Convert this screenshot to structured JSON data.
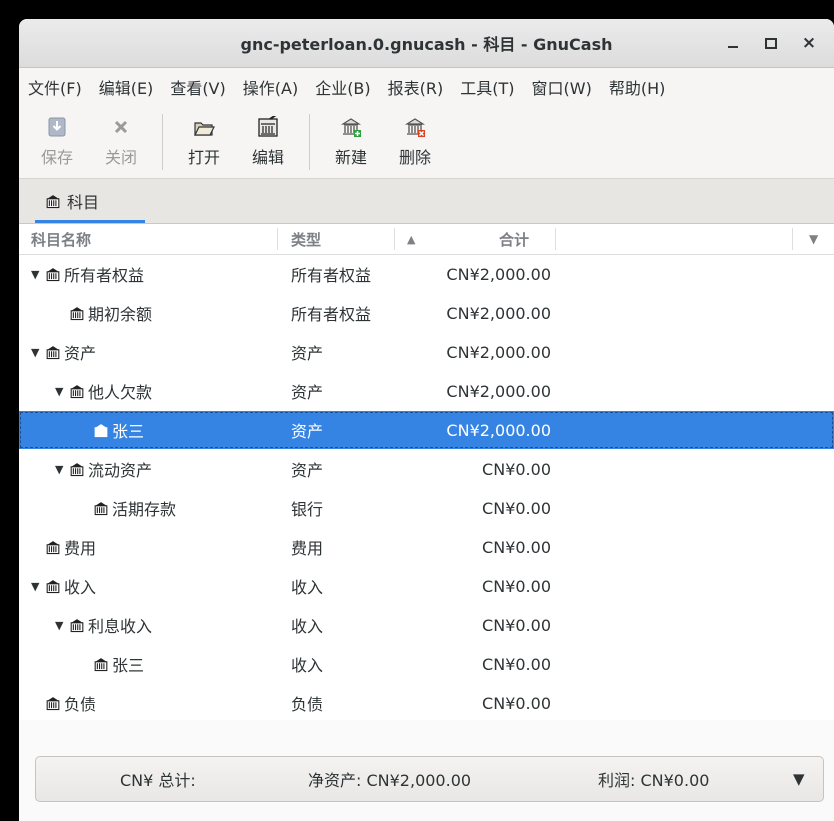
{
  "window": {
    "title": "gnc-peterloan.0.gnucash - 科目 - GnuCash",
    "controls": {
      "minimize": "–",
      "maximize": "□",
      "close": "×"
    }
  },
  "menubar": [
    "文件(F)",
    "编辑(E)",
    "查看(V)",
    "操作(A)",
    "企业(B)",
    "报表(R)",
    "工具(T)",
    "窗口(W)",
    "帮助(H)"
  ],
  "toolbar": {
    "save": {
      "label": "保存",
      "icon": "save-icon",
      "enabled": false
    },
    "close": {
      "label": "关闭",
      "icon": "close-icon",
      "enabled": false
    },
    "open": {
      "label": "打开",
      "icon": "folder-open-icon",
      "enabled": true
    },
    "edit": {
      "label": "编辑",
      "icon": "account-edit-icon",
      "enabled": true
    },
    "new": {
      "label": "新建",
      "icon": "account-new-icon",
      "enabled": true
    },
    "delete": {
      "label": "删除",
      "icon": "account-delete-icon",
      "enabled": true
    }
  },
  "tabs": [
    {
      "label": "科目",
      "icon": "account-icon",
      "active": true
    }
  ],
  "columns": {
    "name": "科目名称",
    "type": "类型",
    "total": "合计",
    "sort_indicator": "▲",
    "column_menu": "▼"
  },
  "accounts": [
    {
      "name": "所有者权益",
      "type": "所有者权益",
      "total": "CN¥2,000.00",
      "depth": 0,
      "expanded": true,
      "selected": false
    },
    {
      "name": "期初余额",
      "type": "所有者权益",
      "total": "CN¥2,000.00",
      "depth": 1,
      "expanded": null,
      "selected": false
    },
    {
      "name": "资产",
      "type": "资产",
      "total": "CN¥2,000.00",
      "depth": 0,
      "expanded": true,
      "selected": false
    },
    {
      "name": "他人欠款",
      "type": "资产",
      "total": "CN¥2,000.00",
      "depth": 1,
      "expanded": true,
      "selected": false
    },
    {
      "name": "张三",
      "type": "资产",
      "total": "CN¥2,000.00",
      "depth": 2,
      "expanded": null,
      "selected": true
    },
    {
      "name": "流动资产",
      "type": "资产",
      "total": "CN¥0.00",
      "depth": 1,
      "expanded": true,
      "selected": false
    },
    {
      "name": "活期存款",
      "type": "银行",
      "total": "CN¥0.00",
      "depth": 2,
      "expanded": null,
      "selected": false
    },
    {
      "name": "费用",
      "type": "费用",
      "total": "CN¥0.00",
      "depth": 0,
      "expanded": null,
      "selected": false
    },
    {
      "name": "收入",
      "type": "收入",
      "total": "CN¥0.00",
      "depth": 0,
      "expanded": true,
      "selected": false
    },
    {
      "name": "利息收入",
      "type": "收入",
      "total": "CN¥0.00",
      "depth": 1,
      "expanded": true,
      "selected": false
    },
    {
      "name": "张三",
      "type": "收入",
      "total": "CN¥0.00",
      "depth": 2,
      "expanded": null,
      "selected": false
    },
    {
      "name": "负债",
      "type": "负债",
      "total": "CN¥0.00",
      "depth": 0,
      "expanded": null,
      "selected": false
    }
  ],
  "statusbar": {
    "currency_total": "CN¥ 总计:",
    "net_assets": "净资产: CN¥2,000.00",
    "profit": "利润: CN¥0.00",
    "dropdown": "▼"
  },
  "colors": {
    "selection": "#3584e4",
    "tab_underline": "#3584e4",
    "new_badge": "#2e9e3e",
    "delete_badge": "#d9441f"
  }
}
